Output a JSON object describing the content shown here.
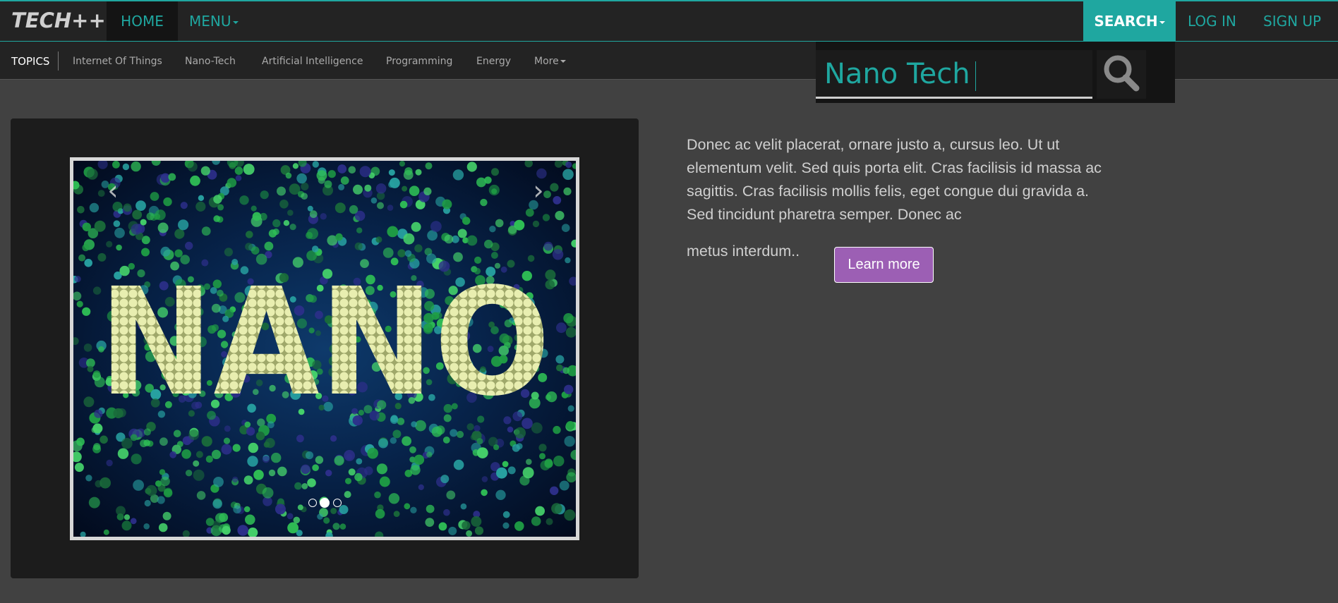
{
  "brand": {
    "logo": "TECH++"
  },
  "nav": {
    "home": "HOME",
    "menu": "MENU",
    "search": "SEARCH",
    "login": "LOG IN",
    "signup": "SIGN UP"
  },
  "topics": {
    "label": "TOPICS",
    "items": [
      "Internet Of Things",
      "Nano-Tech",
      "Artificial Intelligence",
      "Programming",
      "Energy",
      "More"
    ]
  },
  "search": {
    "value": "Nano Tech"
  },
  "carousel": {
    "slide_text": "NANO",
    "prev_icon": "chevron-left-icon",
    "next_icon": "chevron-right-icon",
    "slide_count": 3,
    "active_index": 1
  },
  "feature": {
    "description": "Donec ac velit placerat, ornare justo a, cursus leo. Ut ut elementum velit. Sed quis porta elit. Cras facilisis id massa ac sagittis. Cras facilisis mollis felis, eget congue dui gravida a. Sed tincidunt pharetra semper. Donec ac",
    "description_tail": "metus interdum..",
    "button_label": "Learn more"
  },
  "colors": {
    "accent": "#1fa7a0",
    "button": "#9c5fb4",
    "background": "#414141",
    "navbar": "#232323"
  }
}
